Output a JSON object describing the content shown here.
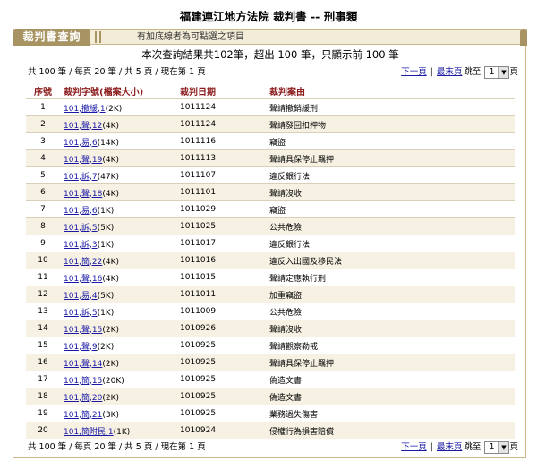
{
  "page": {
    "title": "福建連江地方法院 裁判書 -- 刑事類"
  },
  "tab": {
    "label": "裁判書查詢",
    "hint": "有加底線者為可點選之項目"
  },
  "summary": "本次查詢結果共102筆，超出 100 筆，只顯示前 100 筆",
  "pager": {
    "info": "共 100 筆 / 每頁 20 筆 / 共 5 頁 / 現在第 1 頁",
    "next": "下一頁",
    "last": "最末頁",
    "jump": "跳至",
    "page_value": "1",
    "page_unit": "頁"
  },
  "columns": [
    "序號",
    "裁判字號(檔案大小)",
    "裁判日期",
    "裁判案由"
  ],
  "rows": [
    {
      "seq": "1",
      "case": "101,撤緩,1",
      "size": "(2K)",
      "date": "1011124",
      "reason": "聲請撤銷緩刑"
    },
    {
      "seq": "2",
      "case": "101,聲,12",
      "size": "(4K)",
      "date": "1011124",
      "reason": "聲請發回扣押物"
    },
    {
      "seq": "3",
      "case": "101,易,6",
      "size": "(14K)",
      "date": "1011116",
      "reason": "竊盜"
    },
    {
      "seq": "4",
      "case": "101,聲,19",
      "size": "(4K)",
      "date": "1011113",
      "reason": "聲請具保停止羈押"
    },
    {
      "seq": "5",
      "case": "101,訴,7",
      "size": "(47K)",
      "date": "1011107",
      "reason": "違反銀行法"
    },
    {
      "seq": "6",
      "case": "101,聲,18",
      "size": "(4K)",
      "date": "1011101",
      "reason": "聲請沒收"
    },
    {
      "seq": "7",
      "case": "101,易,6",
      "size": "(1K)",
      "date": "1011029",
      "reason": "竊盜"
    },
    {
      "seq": "8",
      "case": "101,訴,5",
      "size": "(5K)",
      "date": "1011025",
      "reason": "公共危險"
    },
    {
      "seq": "9",
      "case": "101,訴,3",
      "size": "(1K)",
      "date": "1011017",
      "reason": "違反銀行法"
    },
    {
      "seq": "10",
      "case": "101,簡,22",
      "size": "(4K)",
      "date": "1011016",
      "reason": "違反入出國及移民法"
    },
    {
      "seq": "11",
      "case": "101,聲,16",
      "size": "(4K)",
      "date": "1011015",
      "reason": "聲請定應執行刑"
    },
    {
      "seq": "12",
      "case": "101,易,4",
      "size": "(5K)",
      "date": "1011011",
      "reason": "加重竊盜"
    },
    {
      "seq": "13",
      "case": "101,訴,5",
      "size": "(1K)",
      "date": "1011009",
      "reason": "公共危險"
    },
    {
      "seq": "14",
      "case": "101,聲,15",
      "size": "(2K)",
      "date": "1010926",
      "reason": "聲請沒收"
    },
    {
      "seq": "15",
      "case": "101,聲,9",
      "size": "(2K)",
      "date": "1010925",
      "reason": "聲請觀察勒戒"
    },
    {
      "seq": "16",
      "case": "101,聲,14",
      "size": "(2K)",
      "date": "1010925",
      "reason": "聲請具保停止羈押"
    },
    {
      "seq": "17",
      "case": "101,簡,15",
      "size": "(20K)",
      "date": "1010925",
      "reason": "偽造文書"
    },
    {
      "seq": "18",
      "case": "101,簡,20",
      "size": "(2K)",
      "date": "1010925",
      "reason": "偽造文書"
    },
    {
      "seq": "19",
      "case": "101,簡,21",
      "size": "(3K)",
      "date": "1010925",
      "reason": "業務過失傷害"
    },
    {
      "seq": "20",
      "case": "101,簡附民,1",
      "size": "(1K)",
      "date": "1010924",
      "reason": "侵權行為損害賠償"
    }
  ]
}
